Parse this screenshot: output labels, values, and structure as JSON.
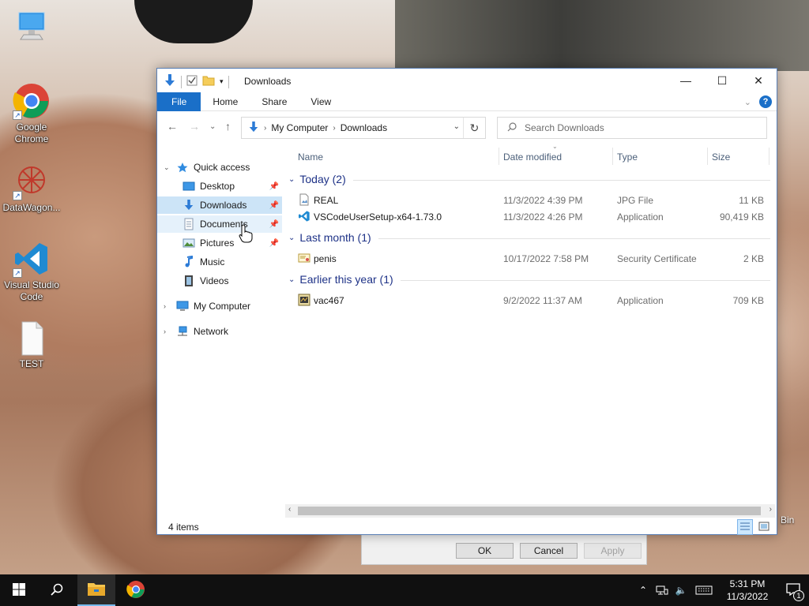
{
  "desktop": {
    "icons": [
      {
        "label": ""
      },
      {
        "label": "Google Chrome"
      },
      {
        "label": "DataWagon..."
      },
      {
        "label": "Visual Studio Code"
      },
      {
        "label": "TEST"
      }
    ],
    "recycle_bin_label": "Bin"
  },
  "window": {
    "title": "Downloads",
    "ribbon_tabs": [
      "File",
      "Home",
      "Share",
      "View"
    ],
    "help": "?",
    "address": {
      "crumbs": [
        "My Computer",
        "Downloads"
      ]
    },
    "search": {
      "placeholder": "Search Downloads"
    },
    "nav_pane": {
      "quick_access": "Quick access",
      "items": [
        {
          "label": "Desktop",
          "pinned": true
        },
        {
          "label": "Downloads",
          "pinned": true
        },
        {
          "label": "Documents",
          "pinned": true
        },
        {
          "label": "Pictures",
          "pinned": true
        },
        {
          "label": "Music",
          "pinned": false
        },
        {
          "label": "Videos",
          "pinned": false
        }
      ],
      "my_computer": "My Computer",
      "network": "Network"
    },
    "columns": {
      "name": "Name",
      "date": "Date modified",
      "type": "Type",
      "size": "Size"
    },
    "groups": [
      {
        "label": "Today (2)",
        "files": [
          {
            "name": "REAL",
            "date": "11/3/2022 4:39 PM",
            "type": "JPG File",
            "size": "11 KB",
            "icon": "image-file-icon"
          },
          {
            "name": "VSCodeUserSetup-x64-1.73.0",
            "date": "11/3/2022 4:26 PM",
            "type": "Application",
            "size": "90,419 KB",
            "icon": "vscode-icon"
          }
        ]
      },
      {
        "label": "Last month (1)",
        "files": [
          {
            "name": "penis",
            "date": "10/17/2022 7:58 PM",
            "type": "Security Certificate",
            "size": "2 KB",
            "icon": "certificate-icon"
          }
        ]
      },
      {
        "label": "Earlier this year (1)",
        "files": [
          {
            "name": "vac467",
            "date": "9/2/2022 11:37 AM",
            "type": "Application",
            "size": "709 KB",
            "icon": "application-icon"
          }
        ]
      }
    ],
    "status": "4 items"
  },
  "dialog": {
    "ok": "OK",
    "cancel": "Cancel",
    "apply": "Apply"
  },
  "taskbar": {
    "time": "5:31 PM",
    "date": "11/3/2022",
    "notification_count": "1"
  },
  "colors": {
    "accent": "#1a6fc8",
    "selection": "#cce4f7",
    "group_text": "#1e3287"
  }
}
